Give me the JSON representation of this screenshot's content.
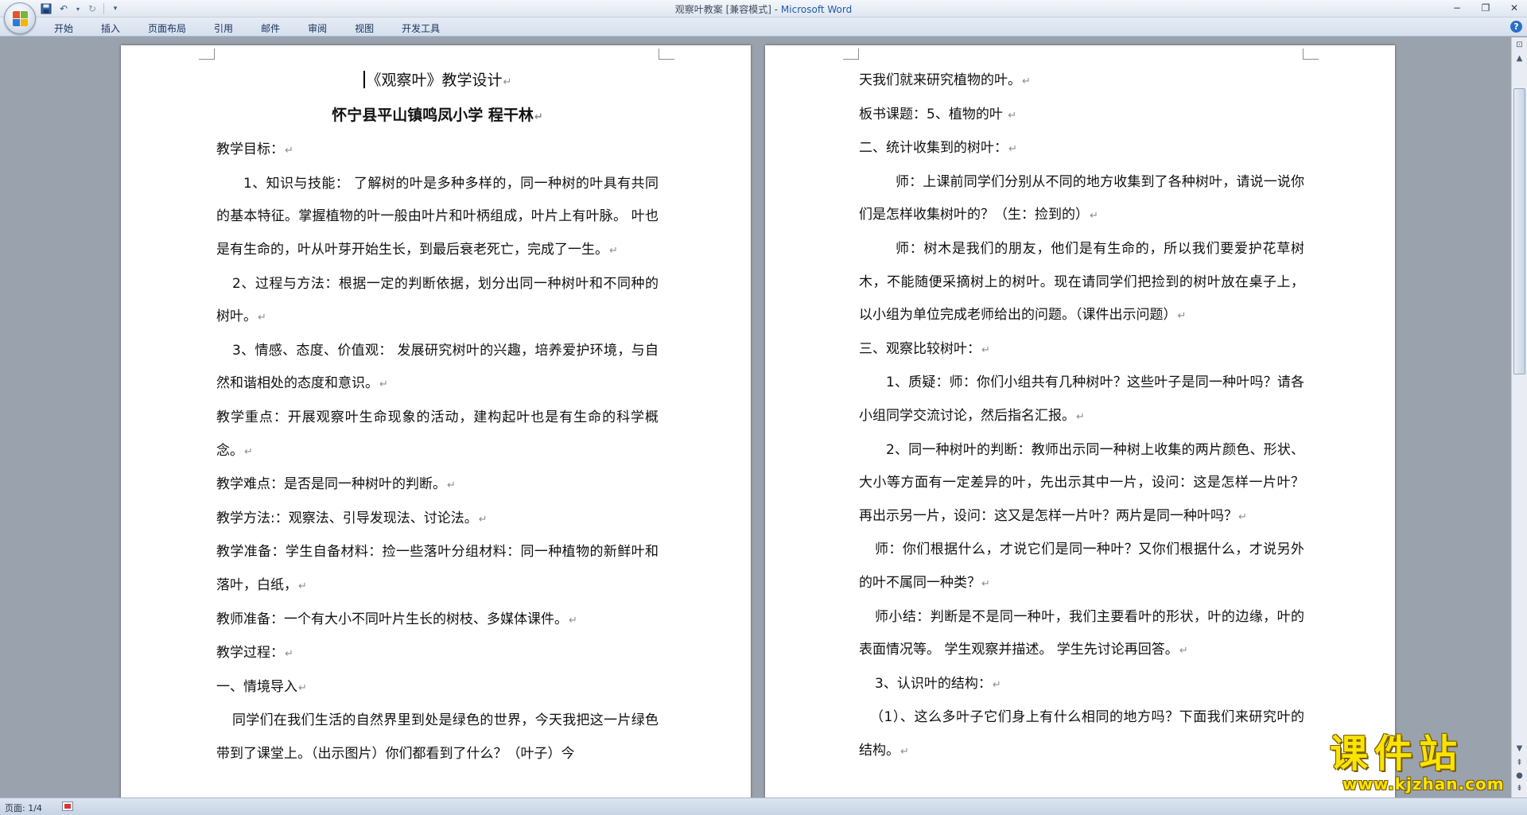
{
  "window": {
    "title_doc": "观察叶教案 [兼容模式] - ",
    "title_app": "Microsoft Word"
  },
  "ribbon": {
    "tabs": [
      "开始",
      "插入",
      "页面布局",
      "引用",
      "邮件",
      "审阅",
      "视图",
      "开发工具"
    ]
  },
  "pages": {
    "left": {
      "title": "《观察叶》教学设计",
      "subtitle": "怀宁县平山镇鸣凤小学      程干林",
      "paragraphs": [
        "教学目标：",
        "1、知识与技能：  了解树的叶是多种多样的，同一种树的叶具有共同的基本特征。掌握植物的叶一般由叶片和叶柄组成，叶片上有叶脉。  叶也是有生命的，叶从叶芽开始生长，到最后衰老死亡，完成了一生。",
        "2、过程与方法：根据一定的判断依据，划分出同一种树叶和不同种的树叶。",
        "3、情感、态度、价值观：  发展研究树叶的兴趣，培养爱护环境，与自然和谐相处的态度和意识。",
        "教学重点：开展观察叶生命现象的活动，建构起叶也是有生命的科学概念。",
        "教学难点：是否是同一种树叶的判断。",
        "教学方法:：观察法、引导发现法、讨论法。",
        "教学准备：学生自备材料：捡一些落叶分组材料：同一种植物的新鲜叶和落叶，白纸，",
        "教师准备：一个有大小不同叶片生长的树枝、多媒体课件。",
        "教学过程：",
        "一、情境导入",
        "同学们在我们生活的自然界里到处是绿色的世界，今天我把这一片绿色带到了课堂上。（出示图片）你们都看到了什么？（叶子）今"
      ]
    },
    "right": {
      "paragraphs": [
        "天我们就来研究植物的叶。",
        "板书课题：5、植物的叶  ",
        "二、统计收集到的树叶：",
        "师：上课前同学们分别从不同的地方收集到了各种树叶，请说一说你们是怎样收集树叶的？（生：捡到的）",
        "师：树木是我们的朋友，他们是有生命的，所以我们要爱护花草树木，不能随便采摘树上的树叶。现在请同学们把捡到的树叶放在桌子上，以小组为单位完成老师给出的问题。（课件出示问题）",
        "三、观察比较树叶：",
        "1、质疑：师：你们小组共有几种树叶？这些叶子是同一种叶吗？请各小组同学交流讨论，然后指名汇报。",
        "2、同一种树叶的判断：教师出示同一种树上收集的两片颜色、形状、大小等方面有一定差异的叶，先出示其中一片，设问：这是怎样一片叶？再出示另一片，设问：这又是怎样一片叶？两片是同一种叶吗？",
        "师：你们根据什么，才说它们是同一种叶？又你们根据什么，才说另外的叶不属同一种类？",
        "师小结：判断是不是同一种叶，我们主要看叶的形状，叶的边缘，叶的表面情况等。  学生观察并描述。  学生先讨论再回答。",
        "3、认识叶的结构：",
        "（1）、这么多叶子它们身上有什么相同的地方吗？下面我们来研究叶的结构。"
      ]
    }
  },
  "status": {
    "page_count": "页面: 1/4"
  },
  "watermark": {
    "title": "课件站",
    "url": "www.kjzhan.com"
  },
  "icons": {
    "office_button": "office-logo-icon",
    "save": "save-icon",
    "undo": "undo-icon",
    "redo": "redo-icon",
    "customize": "dropdown-icon",
    "help": "help-icon"
  },
  "colors": {
    "workspace_bg": "#9aa2ad",
    "app_name": "#1f5aa8",
    "watermark": "#f8e400"
  }
}
